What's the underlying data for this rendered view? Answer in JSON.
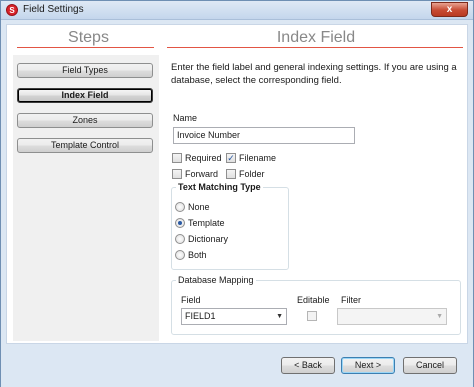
{
  "window": {
    "title": "Field Settings",
    "app_icon_letter": "S",
    "close_glyph": "x"
  },
  "steps": {
    "heading": "Steps",
    "items": [
      {
        "label": "Field Types",
        "active": false
      },
      {
        "label": "Index Field",
        "active": true
      },
      {
        "label": "Zones",
        "active": false
      },
      {
        "label": "Template Control",
        "active": false
      }
    ]
  },
  "main": {
    "heading": "Index Field",
    "instructions": "Enter the field label and general indexing settings. If you are using a database, select the corresponding field.",
    "name_label": "Name",
    "name_value": "Invoice Number",
    "checkboxes": {
      "required": {
        "label": "Required",
        "checked": false
      },
      "filename": {
        "label": "Filename",
        "checked": true
      },
      "forward": {
        "label": "Forward",
        "checked": false
      },
      "folder": {
        "label": "Folder",
        "checked": false
      }
    },
    "text_matching": {
      "legend": "Text Matching Type",
      "options": [
        {
          "label": "None",
          "selected": false
        },
        {
          "label": "Template",
          "selected": true
        },
        {
          "label": "Dictionary",
          "selected": false
        },
        {
          "label": "Both",
          "selected": false
        }
      ]
    },
    "database_mapping": {
      "legend": "Database Mapping",
      "field_label": "Field",
      "field_value": "FIELD1",
      "editable_label": "Editable",
      "editable_checked": false,
      "filter_label": "Filter",
      "filter_value": ""
    }
  },
  "footer": {
    "back_label": "< Back",
    "next_label": "Next >",
    "cancel_label": "Cancel"
  },
  "colors": {
    "accent_rule": "#e25544",
    "chrome": "#dce7f3",
    "check_mark": "#2b5aa3"
  }
}
